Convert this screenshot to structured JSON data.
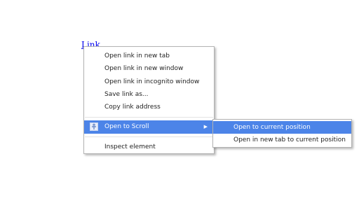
{
  "page": {
    "link_text": "Link"
  },
  "context_menu": {
    "items": [
      {
        "label": "Open link in new tab"
      },
      {
        "label": "Open link in new window"
      },
      {
        "label": "Open link in incognito window"
      },
      {
        "label": "Save link as..."
      },
      {
        "label": "Copy link address"
      }
    ],
    "extension_item": {
      "label": "Open to Scroll",
      "icon": "extension-icon",
      "highlighted": true
    },
    "inspect_item": {
      "label": "Inspect element"
    }
  },
  "submenu": {
    "items": [
      {
        "label": "Open to current position",
        "highlighted": true
      },
      {
        "label": "Open in new tab to current position"
      }
    ]
  },
  "colors": {
    "highlight": "#4c84e8",
    "link": "#0000ee"
  }
}
